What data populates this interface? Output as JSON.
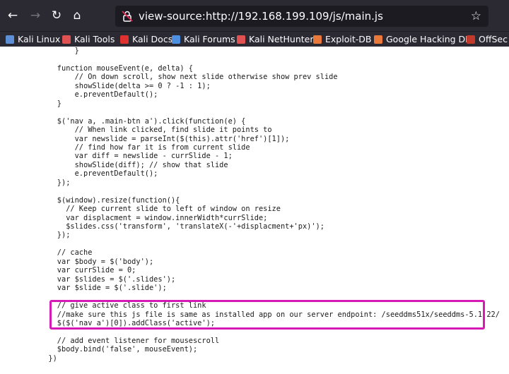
{
  "browser": {
    "url": "view-source:http://192.168.199.109/js/main.js",
    "accent_color": "#d61ab5"
  },
  "bookmarks": [
    {
      "label": "Kali Linux",
      "icon": "kali-dragon-icon",
      "color": "#5c8fd6"
    },
    {
      "label": "Kali Tools",
      "icon": "kali-tools-icon",
      "color": "#e05252"
    },
    {
      "label": "Kali Docs",
      "icon": "kali-docs-icon",
      "color": "#e03131"
    },
    {
      "label": "Kali Forums",
      "icon": "kali-forums-icon",
      "color": "#4d8fe0"
    },
    {
      "label": "Kali NetHunter",
      "icon": "nethunter-icon",
      "color": "#e05252"
    },
    {
      "label": "Exploit-DB",
      "icon": "exploit-db-icon",
      "color": "#e8793a"
    },
    {
      "label": "Google Hacking DB",
      "icon": "ghdb-icon",
      "color": "#e8793a"
    },
    {
      "label": "OffSec",
      "icon": "offsec-icon",
      "color": "#c0392b"
    }
  ],
  "code_lines": [
    "        }",
    "",
    "    function mouseEvent(e, delta) {",
    "        // On down scroll, show next slide otherwise show prev slide",
    "        showSlide(delta >= 0 ? -1 : 1);",
    "        e.preventDefault();",
    "    }",
    "",
    "    $('nav a, .main-btn a').click(function(e) {",
    "        // When link clicked, find slide it points to",
    "        var newslide = parseInt($(this).attr('href')[1]);",
    "        // find how far it is from current slide",
    "        var diff = newslide - currSlide - 1;",
    "        showSlide(diff); // show that slide",
    "        e.preventDefault();",
    "    });",
    "",
    "    $(window).resize(function(){",
    "      // Keep current slide to left of window on resize",
    "      var displacment = window.innerWidth*currSlide;",
    "      $slides.css('transform', 'translateX(-'+displacment+'px)');",
    "    });",
    "",
    "    // cache",
    "    var $body = $('body');",
    "    var currSlide = 0;",
    "    var $slides = $('.slides');",
    "    var $slide = $('.slide');",
    "",
    "    // give active class to first link",
    "    //make sure this js file is same as installed app on our server endpoint: /seeddms51x/seeddms-5.1.22/",
    "    $($('nav a')[0]).addClass('active');",
    "",
    "    // add event listener for mousescroll",
    "    $body.bind('false', mouseEvent);",
    "  })"
  ]
}
